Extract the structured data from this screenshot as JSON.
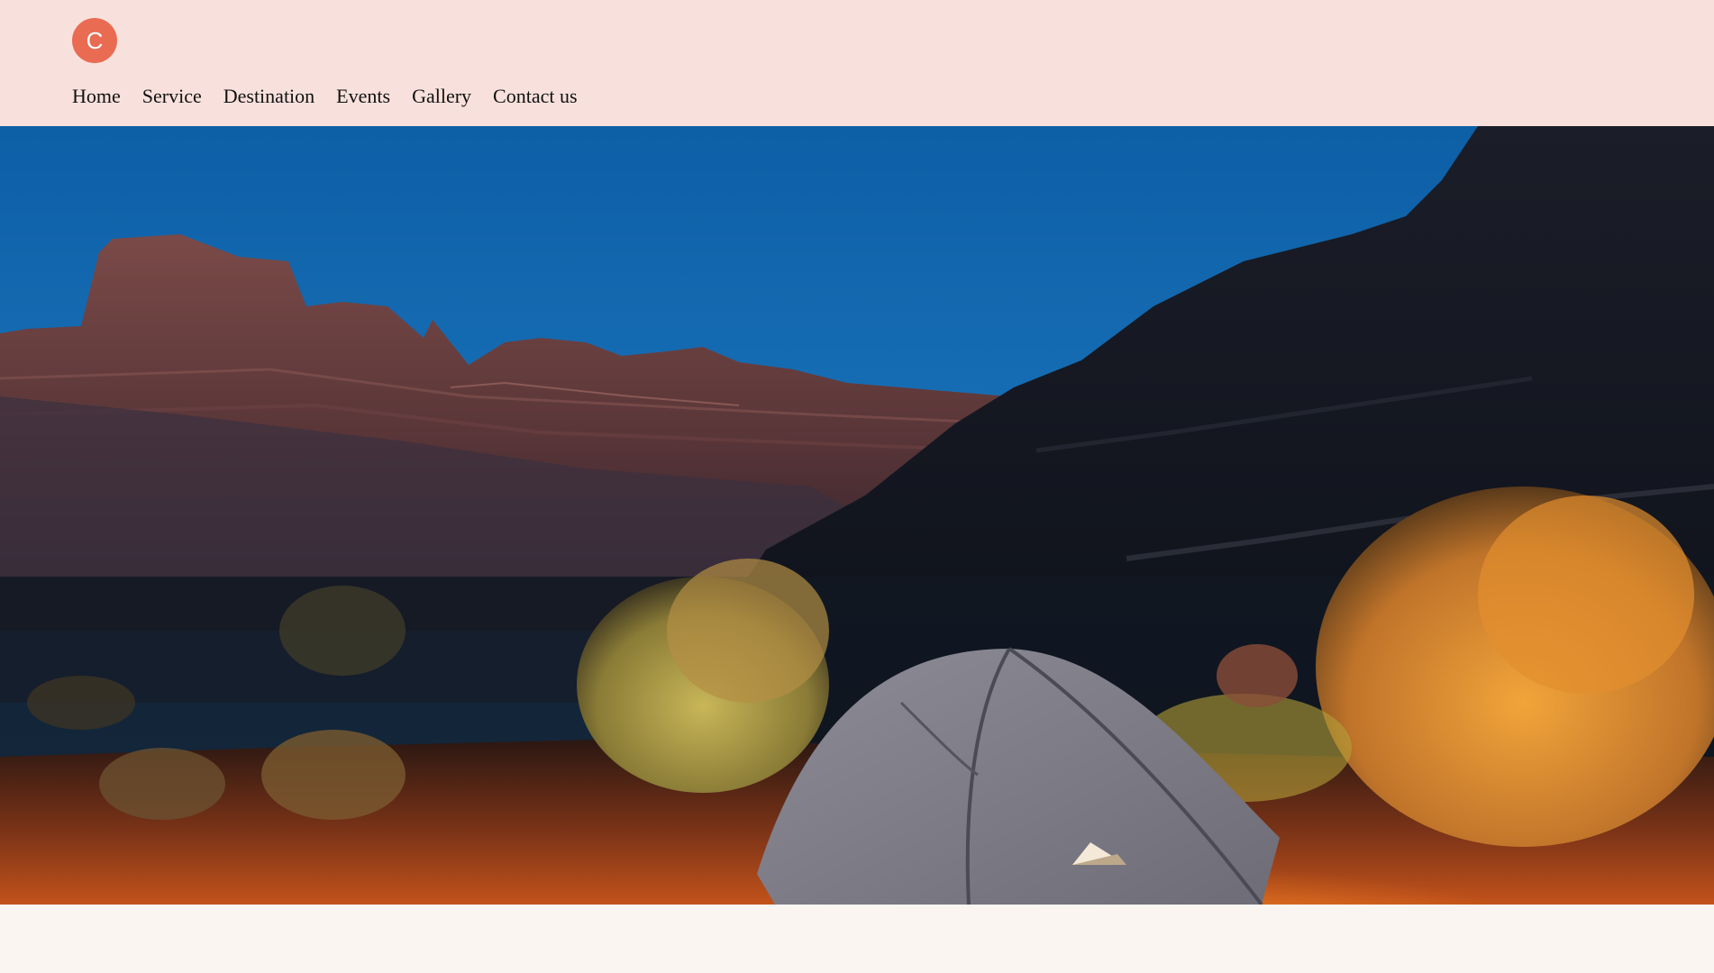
{
  "brand": {
    "logo_letter": "C",
    "logo_color": "#e96b52",
    "header_bg": "#f8e1dc"
  },
  "nav": {
    "items": [
      {
        "label": "Home"
      },
      {
        "label": "Service"
      },
      {
        "label": "Destination"
      },
      {
        "label": "Events"
      },
      {
        "label": "Gallery"
      },
      {
        "label": "Contact us"
      }
    ]
  },
  "hero": {
    "image_subject": "tent-in-desert-canyon-at-dusk-icon"
  }
}
